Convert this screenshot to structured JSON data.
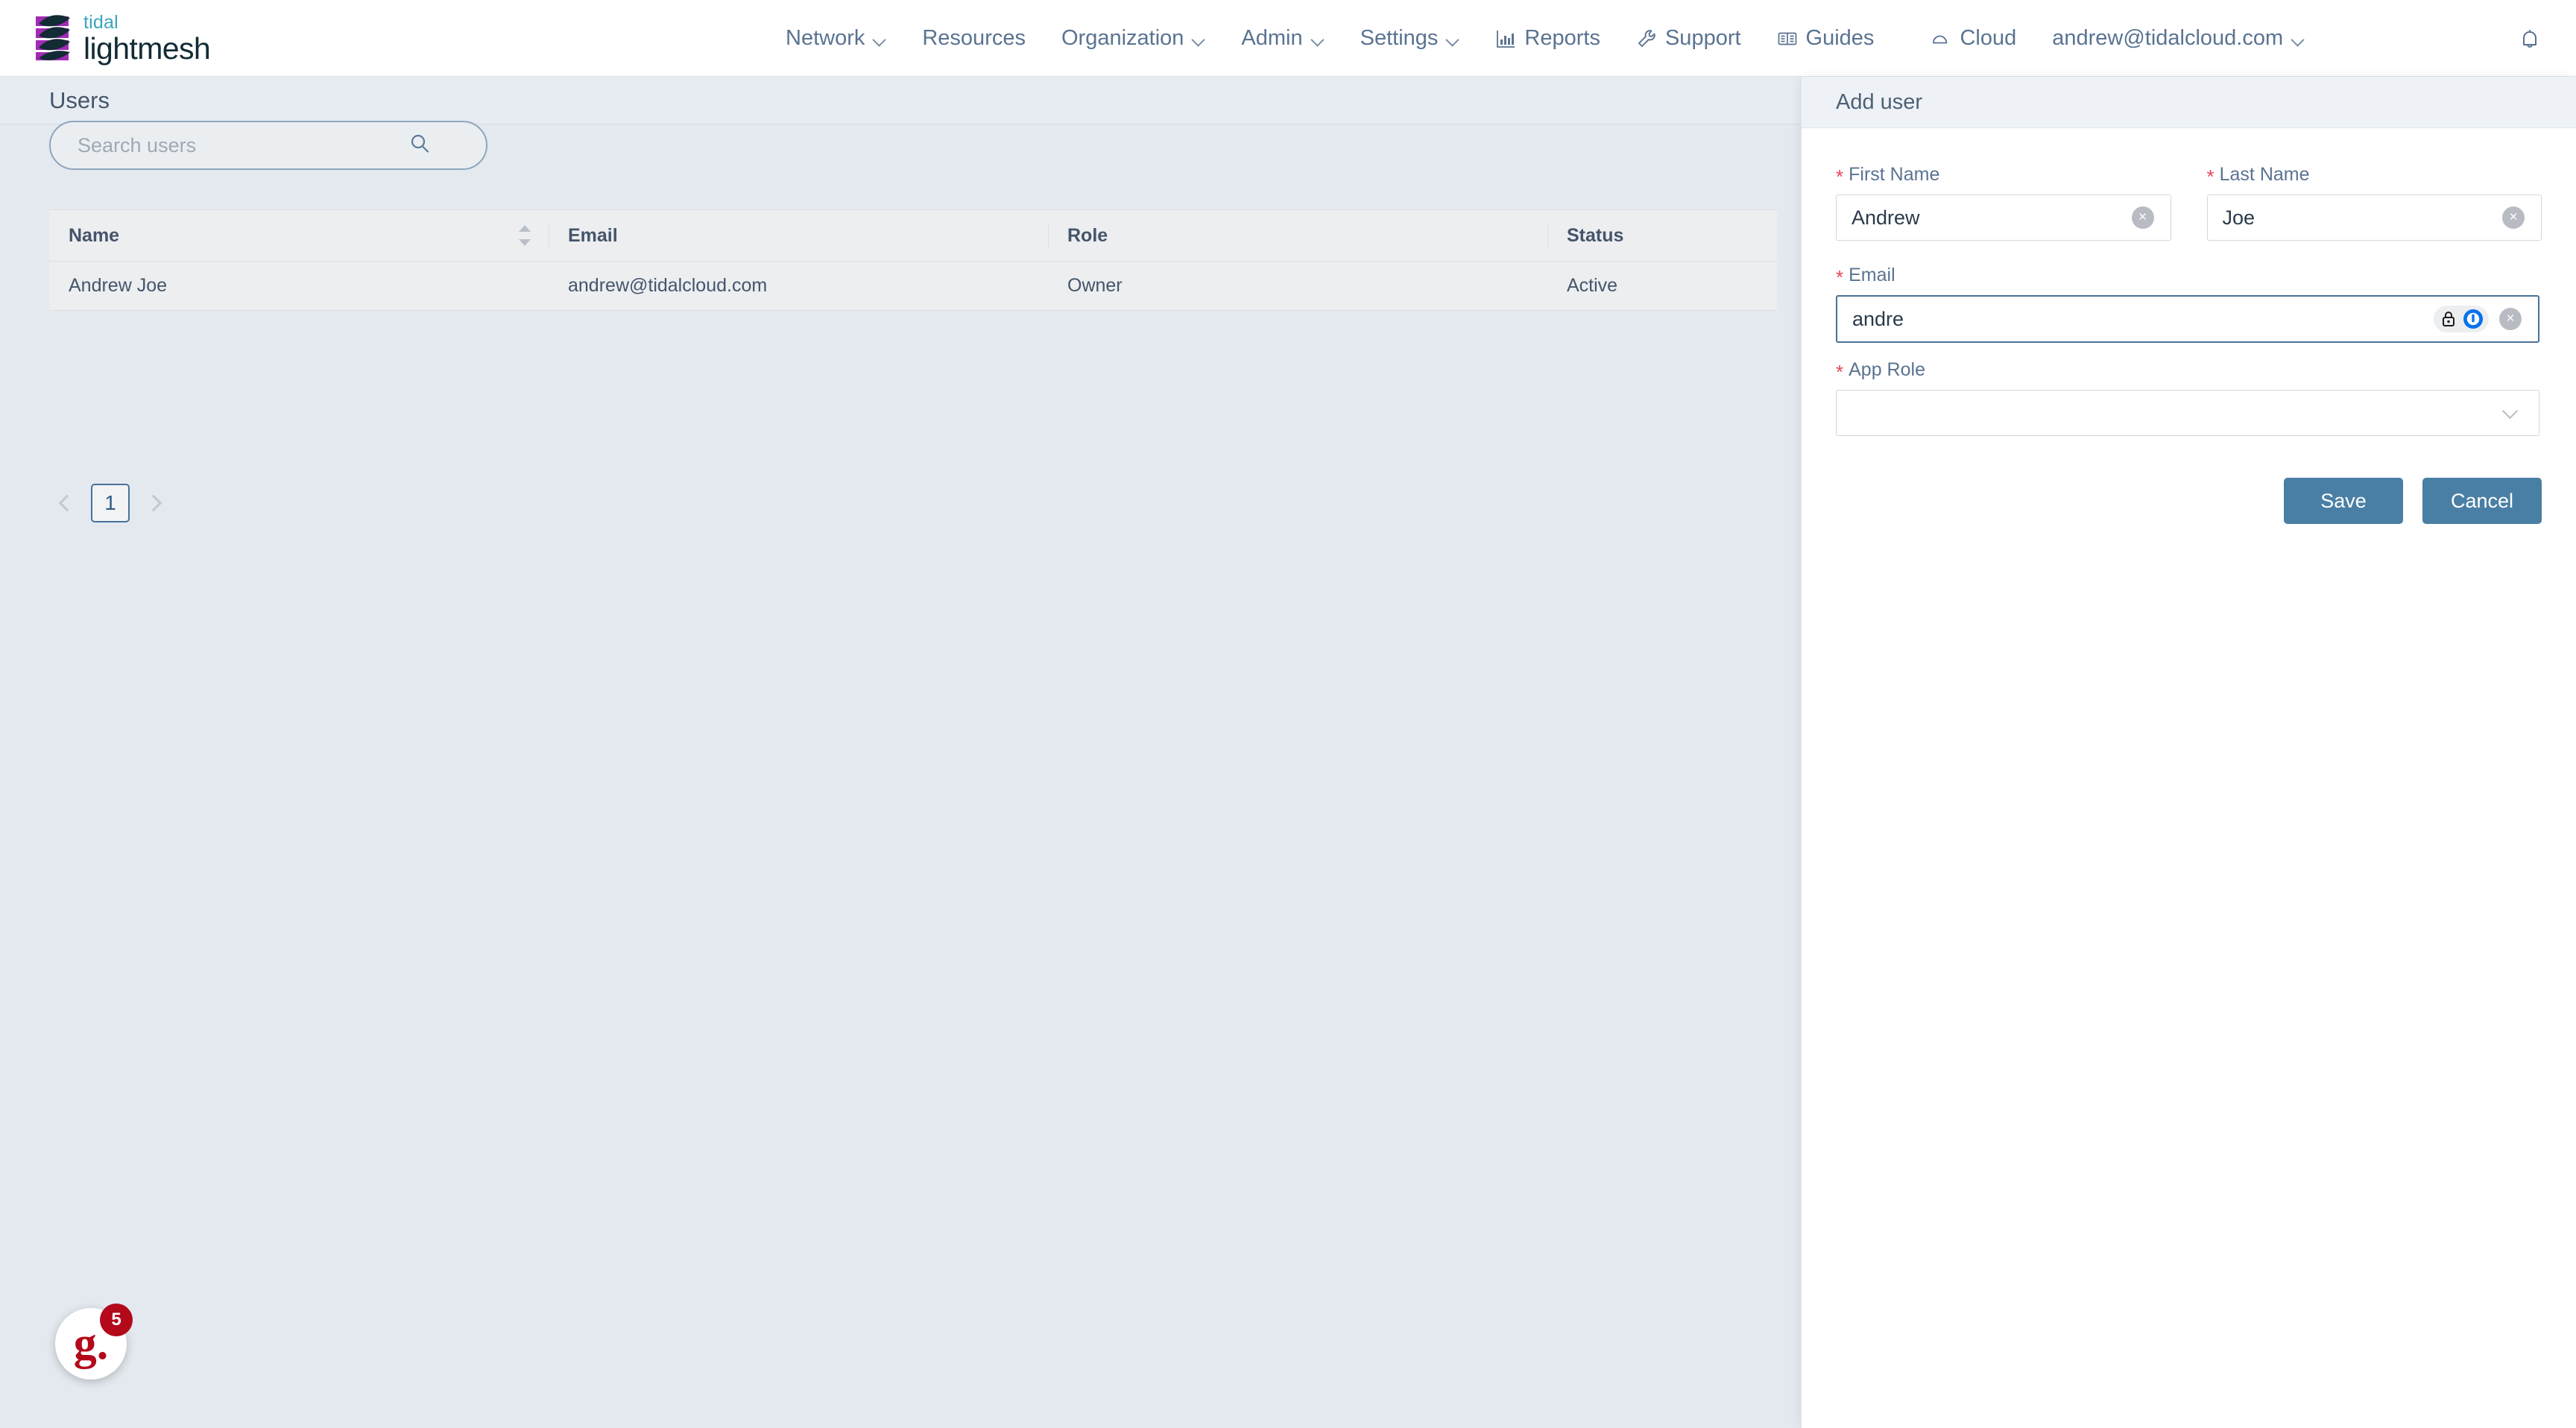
{
  "brand": {
    "logo_top": "tidal",
    "logo_bottom": "lightmesh",
    "logo_purple": "#a12bb5",
    "logo_dark": "#122b35",
    "logo_teal": "#3aa5bd"
  },
  "topnav": {
    "items": [
      {
        "label": "Network",
        "icon": "",
        "caret": true
      },
      {
        "label": "Resources",
        "icon": "",
        "caret": false
      },
      {
        "label": "Organization",
        "icon": "",
        "caret": true
      },
      {
        "label": "Admin",
        "icon": "",
        "caret": true
      },
      {
        "label": "Settings",
        "icon": "",
        "caret": true
      },
      {
        "label": "Reports",
        "icon": "bar-chart-icon",
        "caret": false
      },
      {
        "label": "Support",
        "icon": "wrench-icon",
        "caret": false
      },
      {
        "label": "Guides",
        "icon": "book-icon",
        "caret": false
      },
      {
        "label": "Cloud",
        "icon": "cloud-icon",
        "caret": false
      },
      {
        "label": "andrew@tidalcloud.com",
        "icon": "",
        "caret": true
      }
    ],
    "notifications_icon": "bell-icon",
    "text_color": "#5a7391"
  },
  "page": {
    "title": "Users"
  },
  "search": {
    "placeholder": "Search users",
    "value": "",
    "icon": "search-icon"
  },
  "table": {
    "columns": [
      "Name",
      "Email",
      "Role",
      "Status"
    ],
    "sortable_column": "Name",
    "rows": [
      {
        "name": "Andrew Joe",
        "email": "andrew@tidalcloud.com",
        "role": "Owner",
        "status": "Active"
      }
    ]
  },
  "pagination": {
    "prev": "‹",
    "next": "›",
    "current_page": "1"
  },
  "guides_widget": {
    "glyph": "g.",
    "badge_count": "5",
    "badge_color": "#b3091b"
  },
  "drawer": {
    "title": "Add user",
    "fields": {
      "first_name": {
        "label": "First Name",
        "required_mark": "*",
        "value": "Andrew",
        "clear": "×"
      },
      "last_name": {
        "label": "Last Name",
        "required_mark": "*",
        "value": "Joe",
        "clear": "×"
      },
      "email": {
        "label": "Email",
        "required_mark": "*",
        "value": "andre",
        "clear": "×",
        "extension_icon": "onepassword-icon"
      },
      "app_role": {
        "label": "App Role",
        "required_mark": "*",
        "value": "",
        "placeholder": "",
        "caret_icon": "chevron-down-icon"
      }
    },
    "save_label": "Save",
    "cancel_label": "Cancel",
    "button_color": "#4a7fa5",
    "required_color": "#e8445a"
  }
}
